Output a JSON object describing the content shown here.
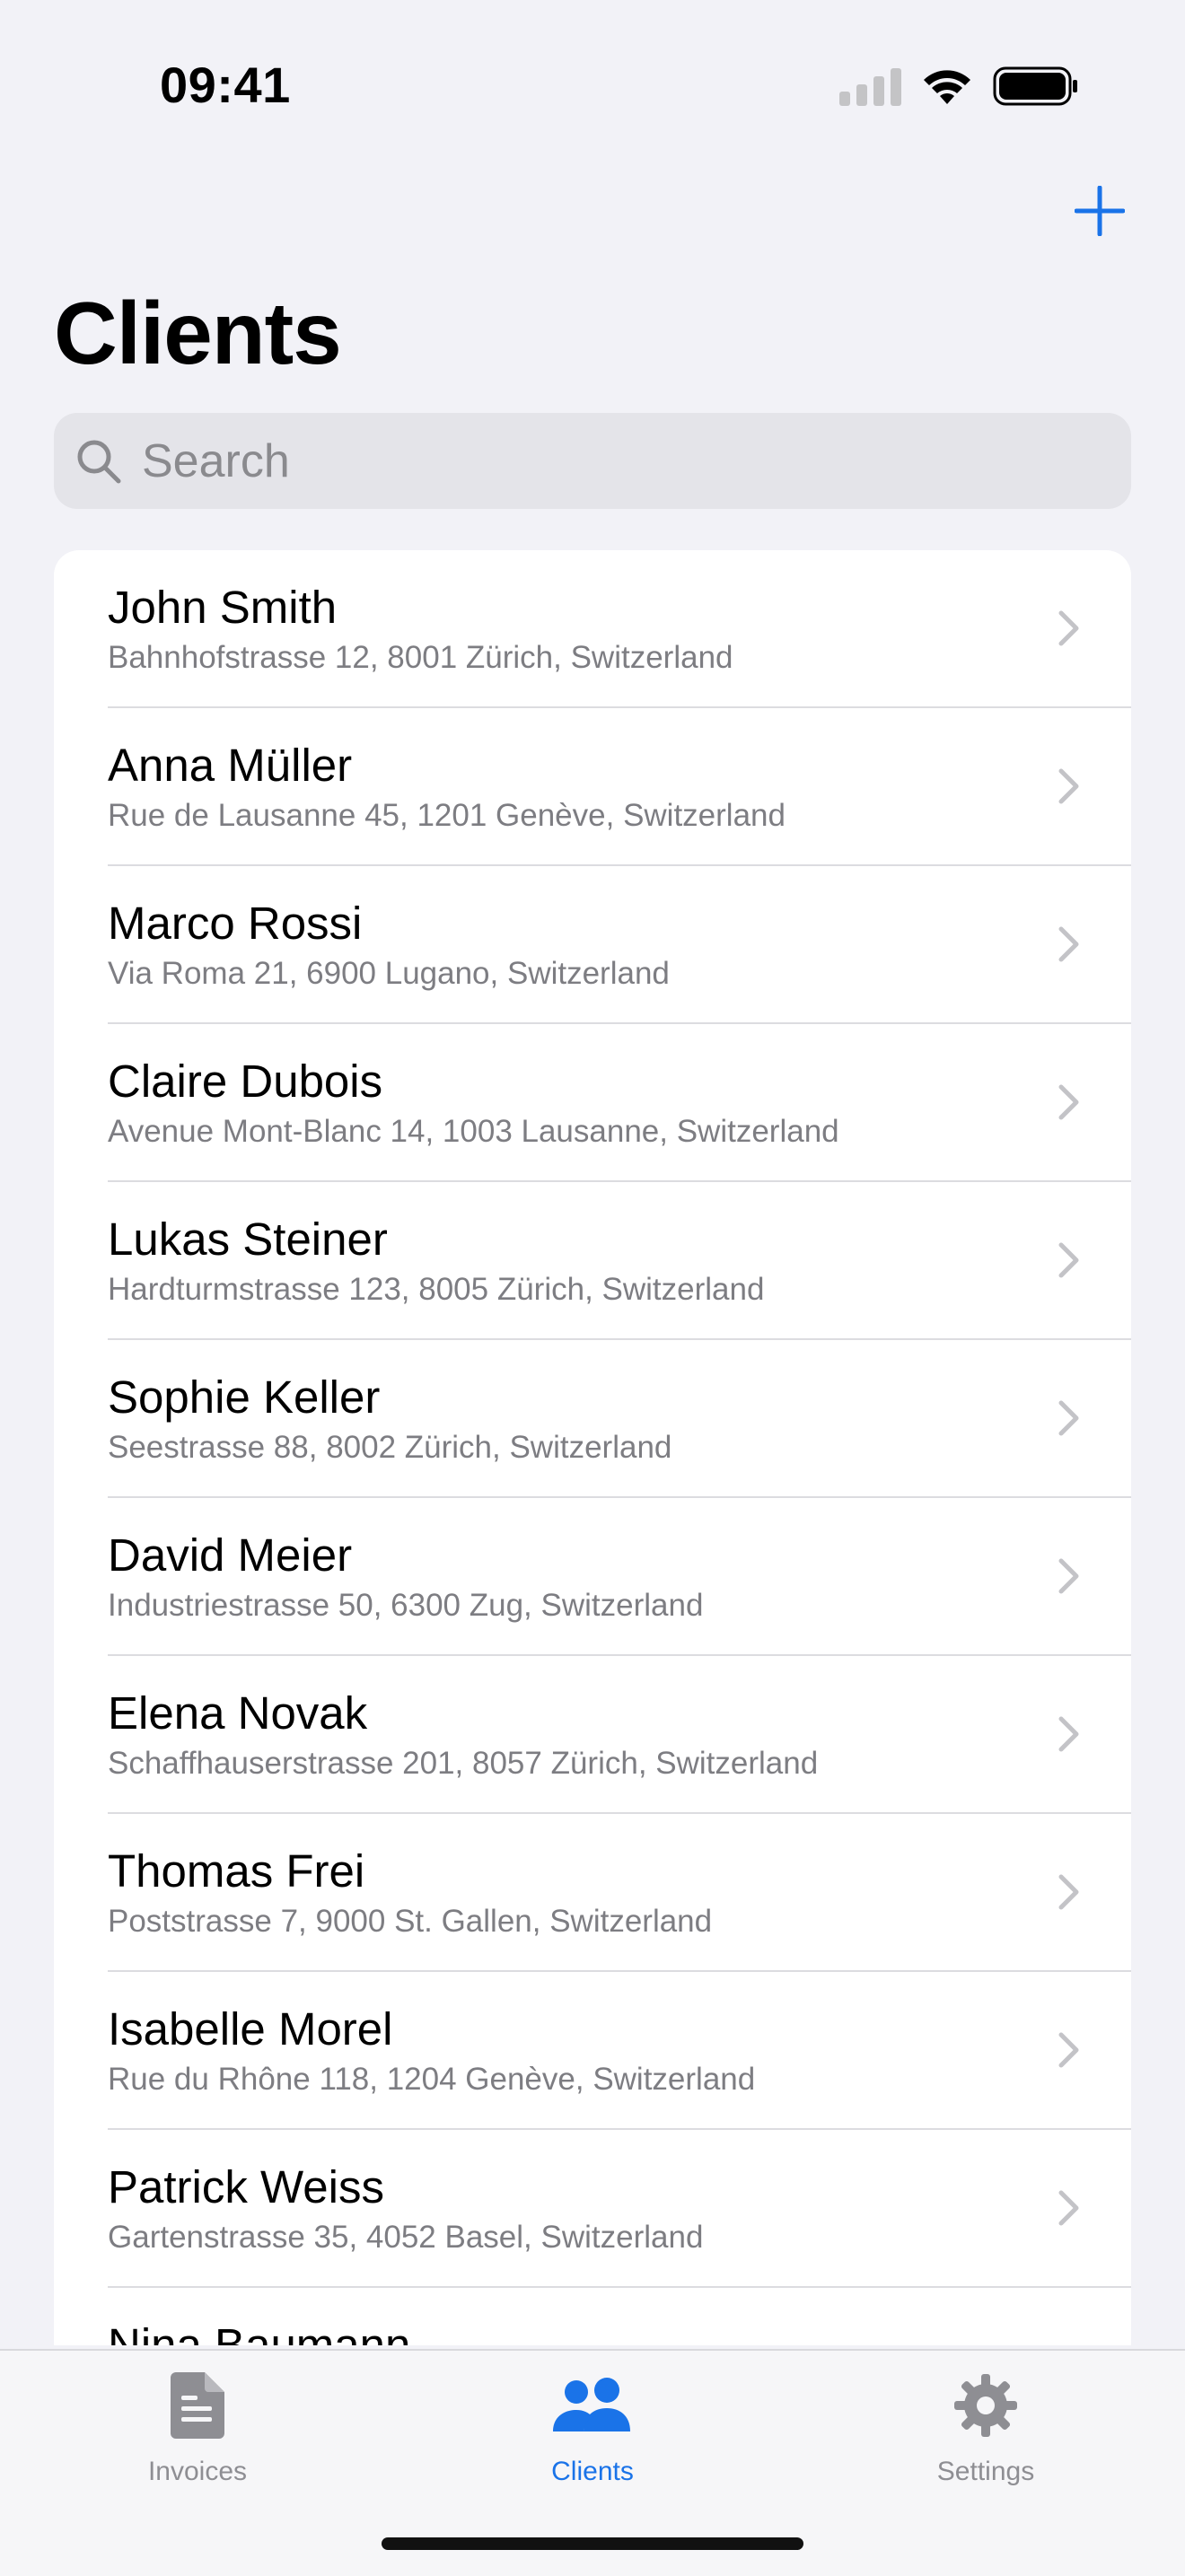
{
  "status_bar": {
    "time": "09:41"
  },
  "header": {
    "title": "Clients",
    "add_icon": "plus-icon"
  },
  "search": {
    "placeholder": "Search",
    "value": ""
  },
  "clients": [
    {
      "name": "John Smith",
      "address": "Bahnhofstrasse 12, 8001 Zürich, Switzerland"
    },
    {
      "name": "Anna Müller",
      "address": "Rue de Lausanne 45, 1201 Genève, Switzerland"
    },
    {
      "name": "Marco Rossi",
      "address": "Via Roma 21, 6900 Lugano, Switzerland"
    },
    {
      "name": "Claire Dubois",
      "address": "Avenue Mont-Blanc 14, 1003 Lausanne, Switzerland"
    },
    {
      "name": "Lukas Steiner",
      "address": "Hardturmstrasse 123, 8005 Zürich, Switzerland"
    },
    {
      "name": "Sophie Keller",
      "address": "Seestrasse 88, 8002 Zürich, Switzerland"
    },
    {
      "name": "David Meier",
      "address": "Industriestrasse 50, 6300 Zug, Switzerland"
    },
    {
      "name": "Elena Novak",
      "address": "Schaffhauserstrasse 201, 8057 Zürich, Switzerland"
    },
    {
      "name": "Thomas Frei",
      "address": "Poststrasse 7, 9000 St. Gallen, Switzerland"
    },
    {
      "name": "Isabelle Morel",
      "address": "Rue du Rhône 118, 1204 Genève, Switzerland"
    },
    {
      "name": "Patrick Weiss",
      "address": "Gartenstrasse 35, 4052 Basel, Switzerland"
    },
    {
      "name": "Nina Baumann",
      "address": ""
    }
  ],
  "tab_bar": {
    "tabs": [
      {
        "label": "Invoices",
        "icon": "document-icon",
        "active": false
      },
      {
        "label": "Clients",
        "icon": "people-icon",
        "active": true
      },
      {
        "label": "Settings",
        "icon": "gear-icon",
        "active": false
      }
    ]
  },
  "colors": {
    "accent": "#1a73e8",
    "background": "#f2f2f7",
    "secondary_text": "#7d7d82",
    "inactive_tab": "#8e8e93"
  }
}
